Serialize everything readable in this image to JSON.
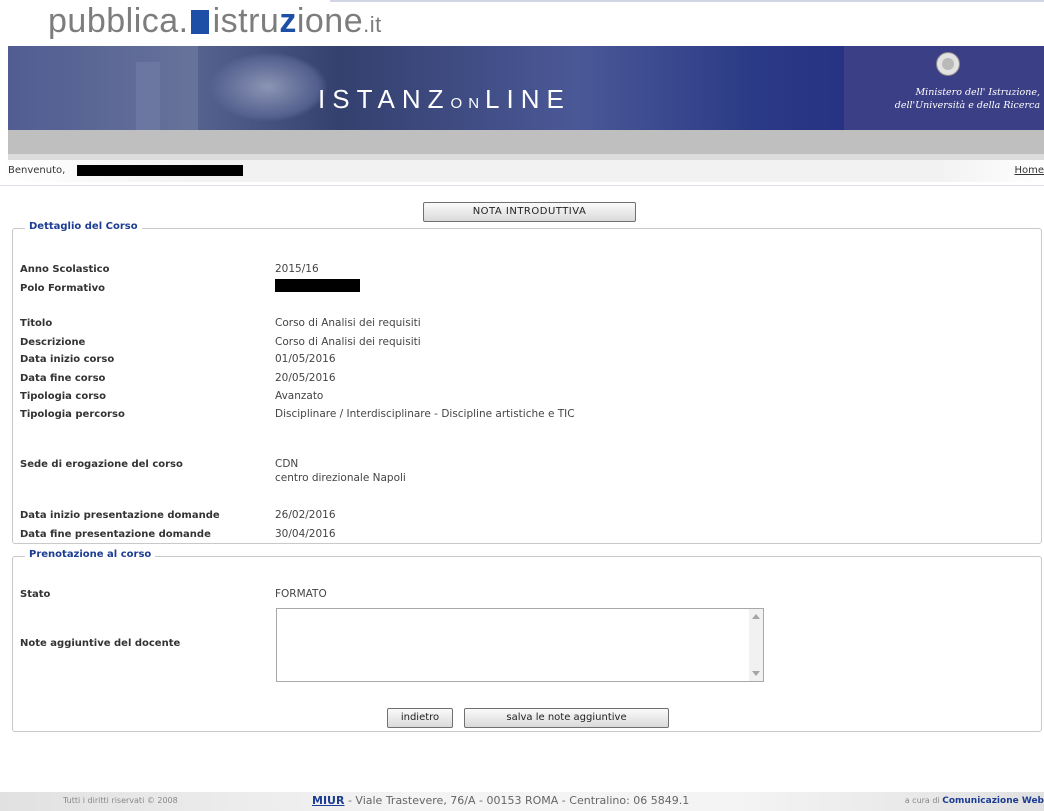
{
  "header": {
    "logo_part1": "pubblica.",
    "logo_part2": "istru",
    "logo_part3": "z",
    "logo_part4": "ione",
    "logo_part5": ".it",
    "banner_title_prefix": "ISTANZ",
    "banner_title_mid": "ON",
    "banner_title_suffix": "LINE",
    "ministry_line1": "Ministero dell' Istruzione,",
    "ministry_line2": "dell'Università e della Ricerca"
  },
  "welcome": {
    "label": "Benvenuto,",
    "home_link": "Home"
  },
  "buttons": {
    "nota": "NOTA INTRODUTTIVA",
    "back": "indietro",
    "save": "salva le note aggiuntive"
  },
  "course_detail": {
    "legend": "Dettaglio del Corso",
    "anno_label": "Anno Scolastico",
    "anno_value": "2015/16",
    "polo_label": "Polo Formativo",
    "titolo_label": "Titolo",
    "titolo_value": "Corso di Analisi dei requisiti",
    "descrizione_label": "Descrizione",
    "descrizione_value": "Corso di Analisi dei requisiti",
    "inizio_label": "Data inizio corso",
    "inizio_value": "01/05/2016",
    "fine_label": "Data fine corso",
    "fine_value": "20/05/2016",
    "tipologia_label": "Tipologia corso",
    "tipologia_value": "Avanzato",
    "percorso_label": "Tipologia percorso",
    "percorso_value": "Disciplinare / Interdisciplinare - Discipline artistiche e TIC",
    "sede_label": "Sede di erogazione del corso",
    "sede_value1": "CDN",
    "sede_value2": "centro direzionale Napoli",
    "pres_inizio_label": "Data inizio presentazione domande",
    "pres_inizio_value": "26/02/2016",
    "pres_fine_label": "Data fine presentazione domande",
    "pres_fine_value": "30/04/2016"
  },
  "booking": {
    "legend": "Prenotazione al corso",
    "stato_label": "Stato",
    "stato_value": "FORMATO",
    "note_label": "Note aggiuntive del docente",
    "note_value": ""
  },
  "footer": {
    "copyright": "Tutti i diritti riservati © 2008",
    "miur": "MIUR",
    "address": " - Viale Trastevere, 76/A - 00153 ROMA - Centralino: 06 5849.1",
    "cura_prefix": "a cura di ",
    "cura_name": "Comunicazione Web"
  }
}
